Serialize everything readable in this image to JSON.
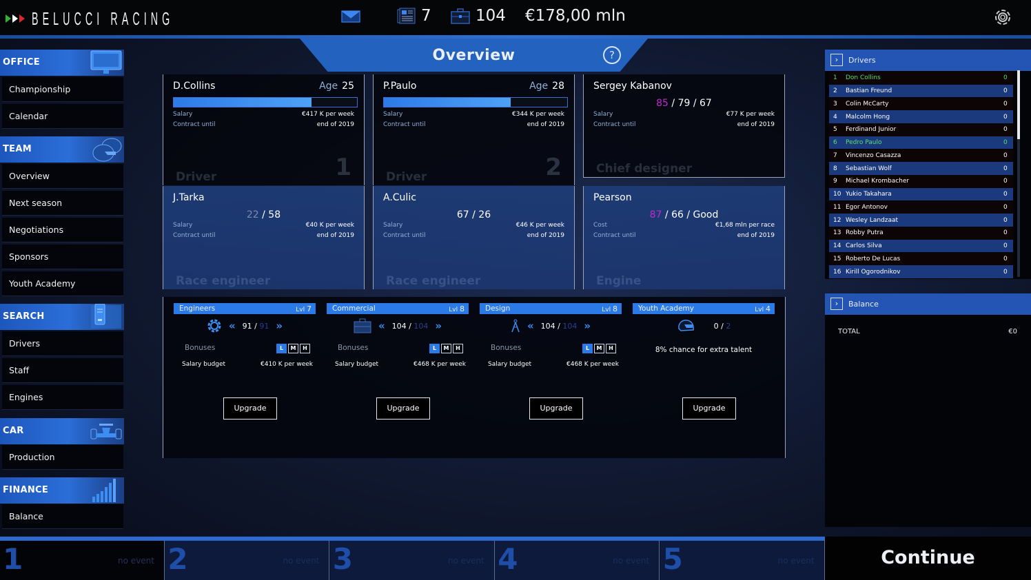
{
  "header": {
    "team_name": "BELUCCI RACING",
    "news_count": "7",
    "staff_count": "104",
    "money": "€178,00 mln",
    "icons": [
      "mail-icon",
      "news-icon",
      "briefcase-icon",
      "settings-gear-icon"
    ]
  },
  "sidebar": {
    "categories": [
      {
        "label": "OFFICE",
        "icon": "monitor-icon",
        "items": [
          "Championship",
          "Calendar"
        ]
      },
      {
        "label": "TEAM",
        "icon": "helmets-icon",
        "items": [
          "Overview",
          "Next season",
          "Negotiations",
          "Sponsors",
          "Youth Academy"
        ]
      },
      {
        "label": "SEARCH",
        "icon": "file-cabinet-icon",
        "items": [
          "Drivers",
          "Staff",
          "Engines"
        ]
      },
      {
        "label": "CAR",
        "icon": "race-car-icon",
        "items": [
          "Production"
        ]
      },
      {
        "label": "FINANCE",
        "icon": "bar-chart-icon",
        "items": [
          "Balance"
        ]
      }
    ]
  },
  "page": {
    "title": "Overview",
    "help_label": "?"
  },
  "cards": {
    "driver1": {
      "name": "D.Collins",
      "age_label": "Age",
      "age": "25",
      "skill_fraction": 0.75,
      "salary_label": "Salary",
      "salary": "€417 K per week",
      "contract_label": "Contract until",
      "contract": "end of 2019",
      "role": "Driver",
      "number": "1"
    },
    "driver2": {
      "name": "P.Paulo",
      "age_label": "Age",
      "age": "28",
      "skill_fraction": 0.69,
      "salary_label": "Salary",
      "salary": "€344 K per week",
      "contract_label": "Contract until",
      "contract": "end of 2019",
      "role": "Driver",
      "number": "2"
    },
    "designer": {
      "name": "Sergey Kabanov",
      "r1": "85",
      "rest": " / 79 / 67",
      "salary_label": "Salary",
      "salary": "€77 K per week",
      "contract_label": "Contract until",
      "contract": "end of 2019",
      "role": "Chief designer"
    },
    "engineer1": {
      "name": "J.Tarka",
      "r1": "22",
      "rest": " / 58",
      "salary_label": "Salary",
      "salary": "€40 K per week",
      "contract_label": "Contract until",
      "contract": "end of 2019",
      "role": "Race engineer"
    },
    "engineer2": {
      "name": "A.Culic",
      "r1": "",
      "rest": "67 / 26",
      "salary_label": "Salary",
      "salary": "€46 K per week",
      "contract_label": "Contract until",
      "contract": "end of 2019",
      "role": "Race engineer"
    },
    "engine": {
      "name": "Pearson",
      "r1": "87",
      "rest": " / 66 / Good",
      "cost_label": "Cost",
      "cost": "€1,68 mln per race",
      "contract_label": "Contract until",
      "contract": "end of 2019",
      "role": "Engine"
    }
  },
  "departments": [
    {
      "name": "Engineers",
      "lvl_prefix": "Lvl",
      "lvl": "7",
      "icon": "gear-icon",
      "current": "91",
      "max": "91",
      "bonuses_label": "Bonuses",
      "bonus_levels": [
        "L",
        "M",
        "H"
      ],
      "selected": "L",
      "salary_label": "Salary budget",
      "salary": "€410 K per week",
      "upgrade": "Upgrade"
    },
    {
      "name": "Commercial",
      "lvl_prefix": "Lvl",
      "lvl": "8",
      "icon": "briefcase-icon",
      "current": "104",
      "max": "104",
      "bonuses_label": "Bonuses",
      "bonus_levels": [
        "L",
        "M",
        "H"
      ],
      "selected": "L",
      "salary_label": "Salary budget",
      "salary": "€468 K per week",
      "upgrade": "Upgrade"
    },
    {
      "name": "Design",
      "lvl_prefix": "Lvl",
      "lvl": "8",
      "icon": "compass-icon",
      "current": "104",
      "max": "104",
      "bonuses_label": "Bonuses",
      "bonus_levels": [
        "L",
        "M",
        "H"
      ],
      "selected": "L",
      "salary_label": "Salary budget",
      "salary": "€468 K per week",
      "upgrade": "Upgrade"
    },
    {
      "name": "Youth Academy",
      "lvl_prefix": "Lvl",
      "lvl": "4",
      "icon": "helmet-icon",
      "current": "0",
      "max": "2",
      "extra": "8% chance for extra talent",
      "upgrade": "Upgrade"
    }
  ],
  "drivers_panel": {
    "title": "Drivers",
    "rows": [
      {
        "pos": "1",
        "name": "Don Collins",
        "pts": "0",
        "own": true
      },
      {
        "pos": "2",
        "name": "Bastian Freund",
        "pts": "0"
      },
      {
        "pos": "3",
        "name": "Colin McCarty",
        "pts": "0"
      },
      {
        "pos": "4",
        "name": "Malcolm Hong",
        "pts": "0"
      },
      {
        "pos": "5",
        "name": "Ferdinand Junior",
        "pts": "0"
      },
      {
        "pos": "6",
        "name": "Pedro Paulo",
        "pts": "0",
        "own": true
      },
      {
        "pos": "7",
        "name": "Vincenzo Casazza",
        "pts": "0"
      },
      {
        "pos": "8",
        "name": "Sebastian Wolf",
        "pts": "0"
      },
      {
        "pos": "9",
        "name": "Michael Krombacher",
        "pts": "0"
      },
      {
        "pos": "10",
        "name": "Yukio Takahara",
        "pts": "0"
      },
      {
        "pos": "11",
        "name": "Egor Antonov",
        "pts": "0"
      },
      {
        "pos": "12",
        "name": "Wesley Landzaat",
        "pts": "0"
      },
      {
        "pos": "13",
        "name": "Robby Putra",
        "pts": "0"
      },
      {
        "pos": "14",
        "name": "Carlos Silva",
        "pts": "0"
      },
      {
        "pos": "15",
        "name": "Roberto De Lucas",
        "pts": "0"
      },
      {
        "pos": "16",
        "name": "Kirill Ogorodnikov",
        "pts": "0"
      }
    ]
  },
  "balance_panel": {
    "title": "Balance",
    "total_label": "TOTAL",
    "total": "€0"
  },
  "timeline": [
    {
      "n": "1",
      "event": "no event"
    },
    {
      "n": "2",
      "event": "no event"
    },
    {
      "n": "3",
      "event": "no event"
    },
    {
      "n": "4",
      "event": "no event"
    },
    {
      "n": "5",
      "event": "no event"
    }
  ],
  "continue_label": "Continue",
  "colors": {
    "accent": "#2c7ae8",
    "panel_blue": "#2455b5",
    "highlight_green": "#58e06a",
    "rating_purple": "#c02ac8"
  }
}
